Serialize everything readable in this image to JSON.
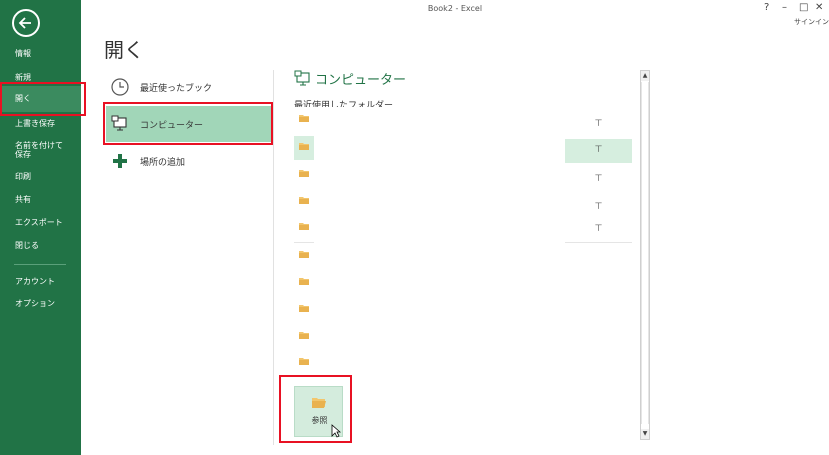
{
  "window": {
    "title": "Book2 - Excel",
    "help": "?",
    "minimize": "–",
    "maximize": "□",
    "close": "✕",
    "signin": "サインイン"
  },
  "sidebar": {
    "items": [
      {
        "label": "情報"
      },
      {
        "label": "新規"
      },
      {
        "label": "開く"
      },
      {
        "label": "上書き保存"
      },
      {
        "label": "名前を付けて"
      },
      {
        "label": "保存"
      },
      {
        "label": "印刷"
      },
      {
        "label": "共有"
      },
      {
        "label": "エクスポート"
      },
      {
        "label": "閉じる"
      },
      {
        "label": "アカウント"
      },
      {
        "label": "オプション"
      }
    ]
  },
  "main": {
    "title": "開く",
    "places": [
      {
        "label": "最近使ったブック",
        "icon": "clock-icon"
      },
      {
        "label": "コンピューター",
        "icon": "computer-icon"
      },
      {
        "label": "場所の追加",
        "icon": "plus-icon"
      }
    ],
    "computer": {
      "title": "コンピューター",
      "recent_folders_title": "最近使用したフォルダー",
      "pin_glyph": "⊤"
    },
    "browse_label": "参照"
  },
  "colors": {
    "sidebar": "#217346",
    "selected_place": "#a1d6b8",
    "highlight_row": "#d6eedf",
    "accent": "#217346",
    "annotation": "#e81123"
  }
}
